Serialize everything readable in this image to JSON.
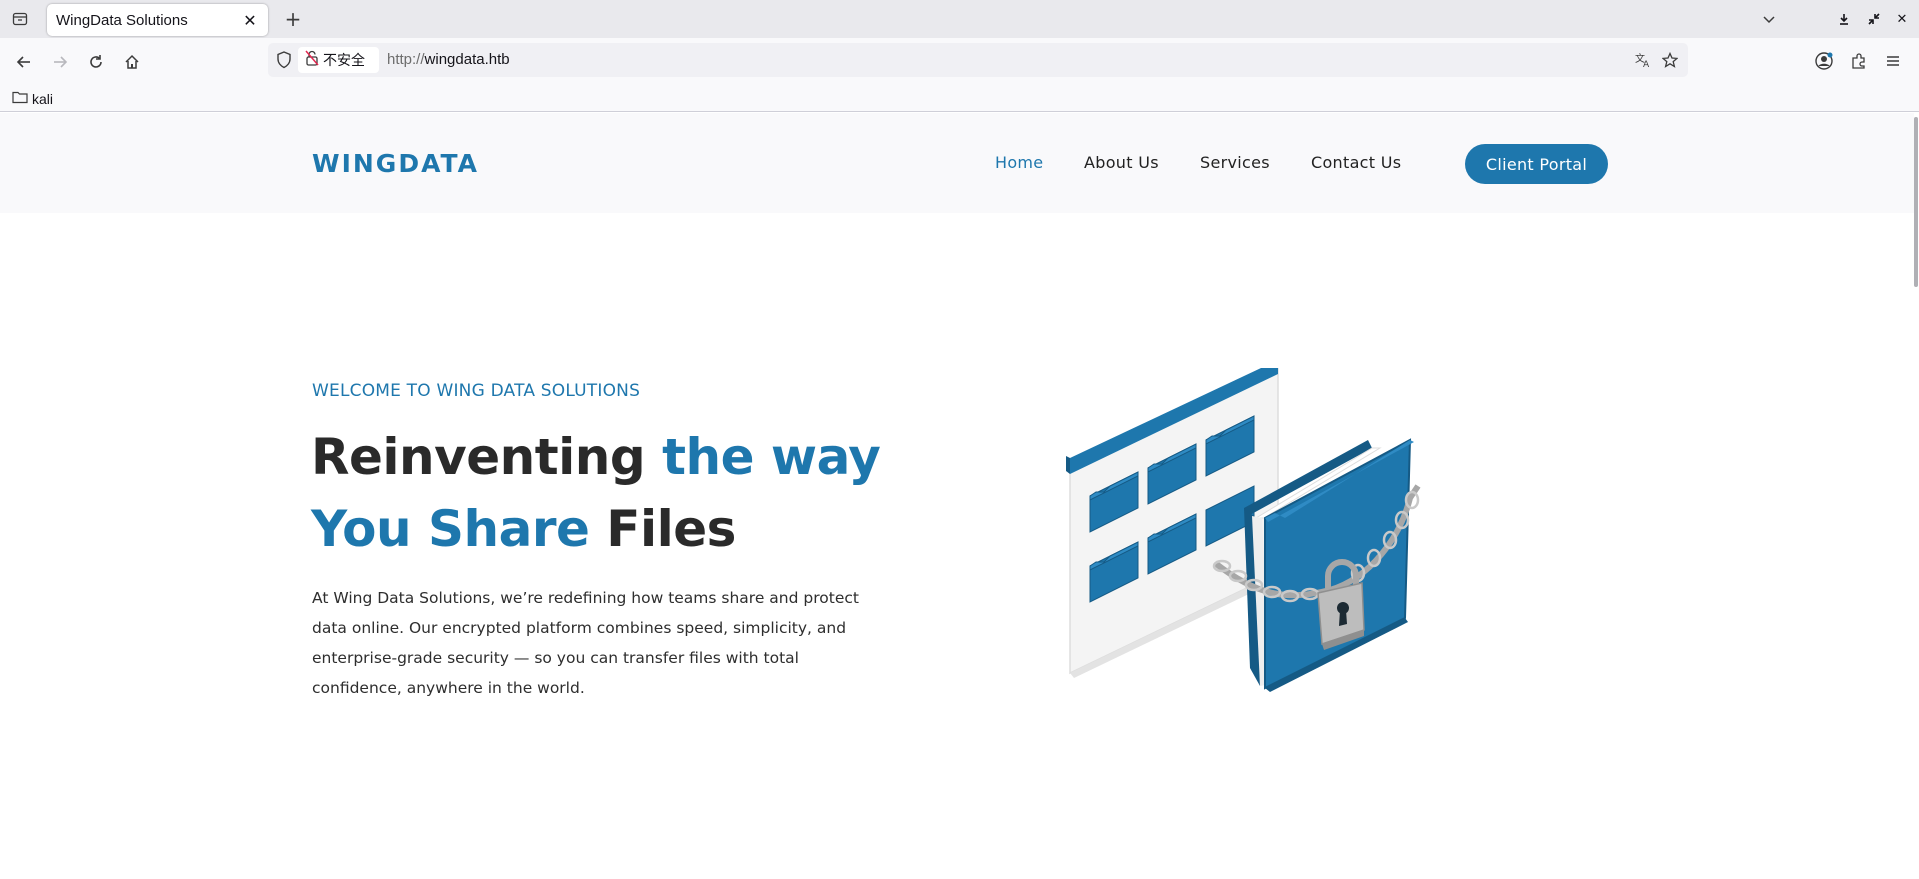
{
  "browser": {
    "tab_title": "WingData Solutions",
    "security_label": "不安全",
    "url_scheme": "http://",
    "url_host": "wingdata.htb",
    "bookmark_label": "kali"
  },
  "site": {
    "logo": "WINGDATA",
    "nav": {
      "home": "Home",
      "about": "About Us",
      "services": "Services",
      "contact": "Contact Us"
    },
    "portal_button": "Client Portal",
    "hero": {
      "kicker": "WELCOME TO WING DATA SOLUTIONS",
      "title_part1": "Reinventing ",
      "title_part2": "the way",
      "title_part3": "You Share",
      "title_part4": " Files",
      "body": "At Wing Data Solutions, we’re redefining how teams share and protect data online. Our encrypted platform combines speed, simplicity, and enterprise-grade security — so you can transfer files with total confidence, anywhere in the world."
    },
    "colors": {
      "brand": "#1e77ad",
      "text": "#2a2a2a",
      "header_bg": "#f9f9fb"
    }
  }
}
